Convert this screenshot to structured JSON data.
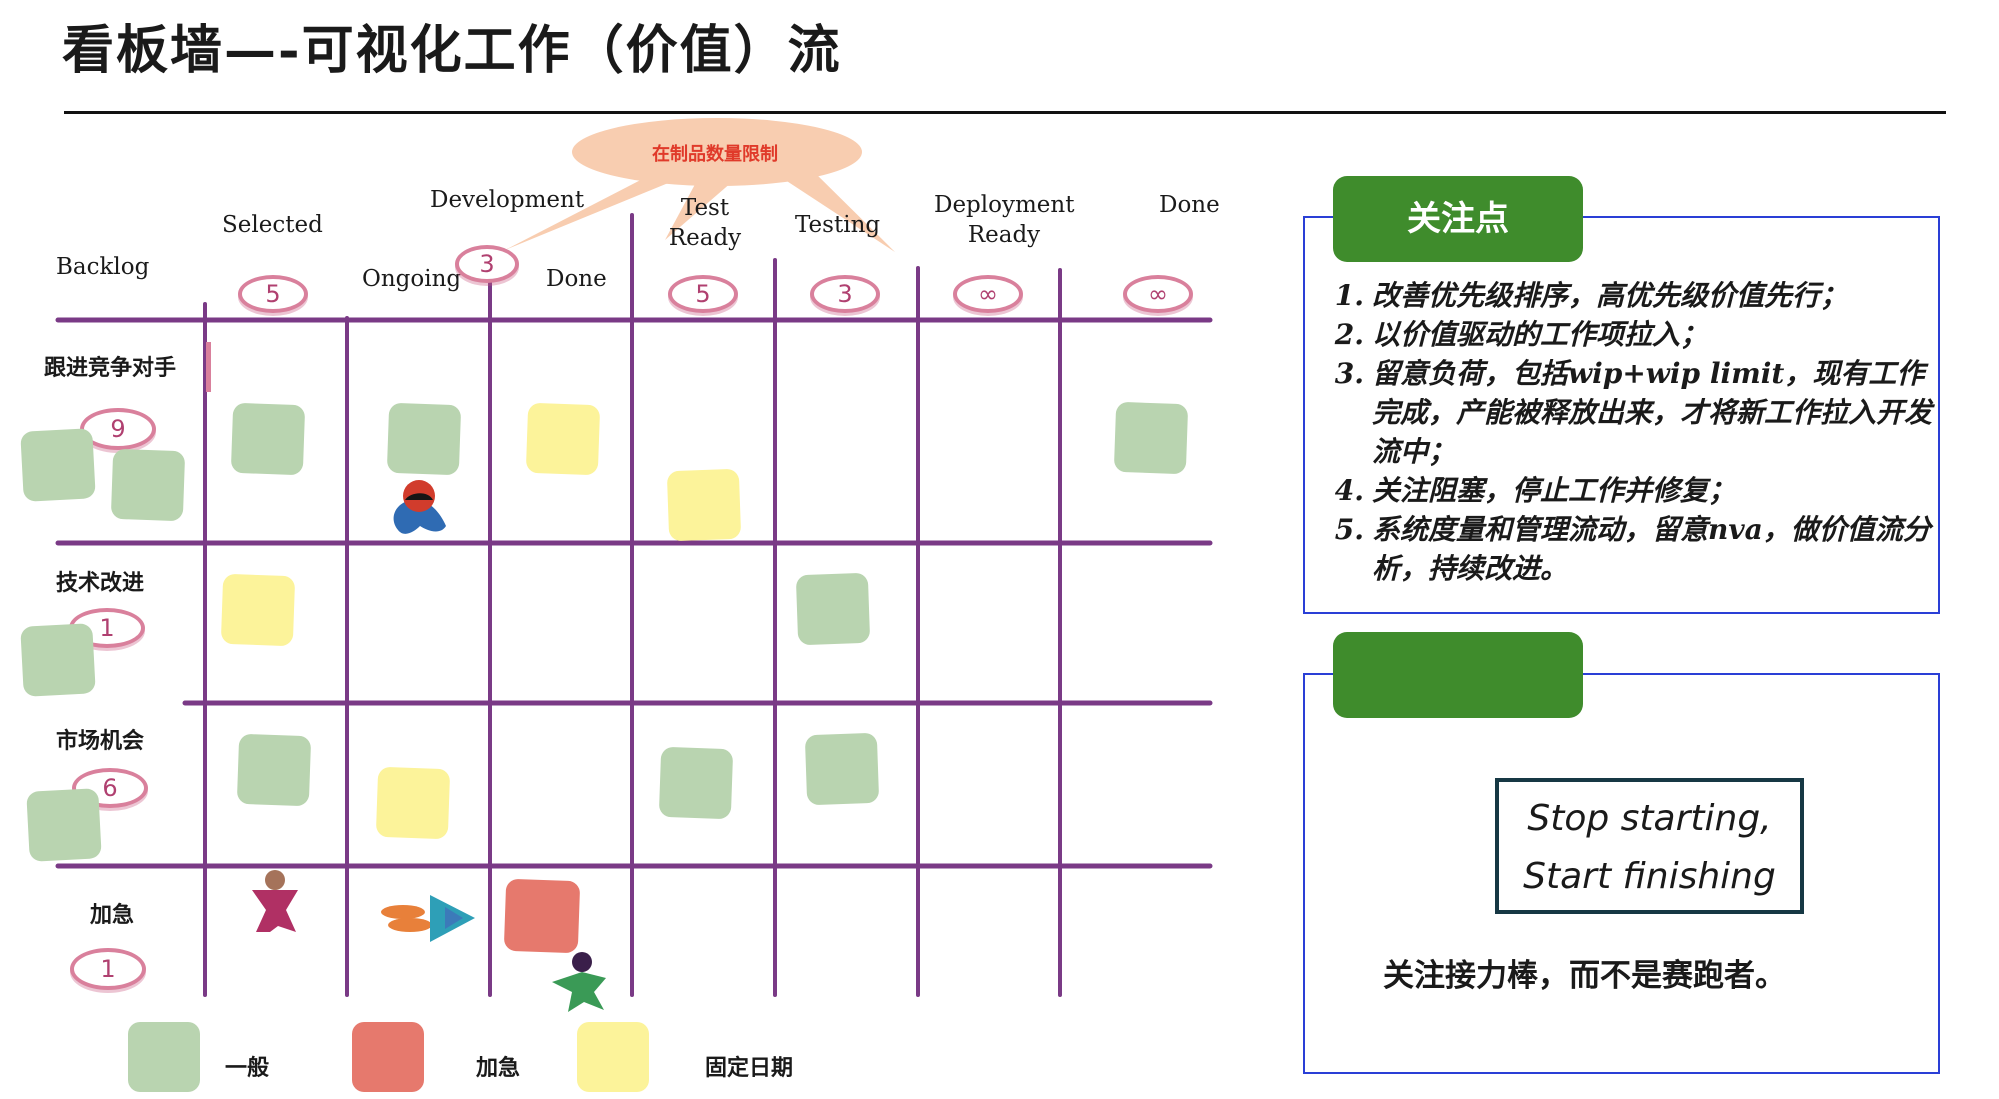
{
  "title": "看板墙—-可视化工作（价值）流",
  "callout": "在制品数量限制",
  "columns": {
    "backlog": "Backlog",
    "selected": "Selected",
    "development": "Development",
    "ongoing": "Ongoing",
    "dev_done": "Done",
    "test_ready": "Test\nReady",
    "testing": "Testing",
    "deployment_ready": "Deployment\nReady",
    "done": "Done"
  },
  "wip_limits": {
    "selected": "5",
    "development": "3",
    "test_ready": "5",
    "testing": "3",
    "deployment_ready": "∞",
    "done": "∞"
  },
  "rows": [
    {
      "label": "跟进竞争对手",
      "limit": "9"
    },
    {
      "label": "技术改进",
      "limit": "1"
    },
    {
      "label": "市场机会",
      "limit": "6"
    },
    {
      "label": "加急",
      "limit": "1"
    }
  ],
  "legend": [
    {
      "label": "一般",
      "color": "#b9d4b0"
    },
    {
      "label": "加急",
      "color": "#e6796d"
    },
    {
      "label": "固定日期",
      "color": "#fcf39a"
    }
  ],
  "colors": {
    "card_general": "#b9d4b0",
    "card_urgent": "#e6796d",
    "card_fixed_date": "#fcf39a",
    "grid": "#7a3a86",
    "panel_border": "#2a3fd6",
    "tab_green": "#3f8c2c",
    "callout_fill": "#f8cdb0",
    "callout_text": "#e03a2a"
  },
  "focus_panel": {
    "tab_label": "关注点",
    "items": [
      {
        "num": "1.",
        "text": "改善优先级排序，高优先级价值先行；"
      },
      {
        "num": "2.",
        "text": "以价值驱动的工作项拉入；"
      },
      {
        "num": "3.",
        "text": "留意负荷，包括wip+wip limit，现有工作完成，产能被释放出来，才将新工作拉入开发流中；"
      },
      {
        "num": "4.",
        "text": "关注阻塞，停止工作并修复；"
      },
      {
        "num": "5.",
        "text": "系统度量和管理流动，留意nva，做价值流分析，持续改进。"
      }
    ]
  },
  "relay_panel": {
    "motto_line1": "Stop starting,",
    "motto_line2": "Start finishing",
    "caption": "关注接力棒，而不是赛跑者。"
  }
}
